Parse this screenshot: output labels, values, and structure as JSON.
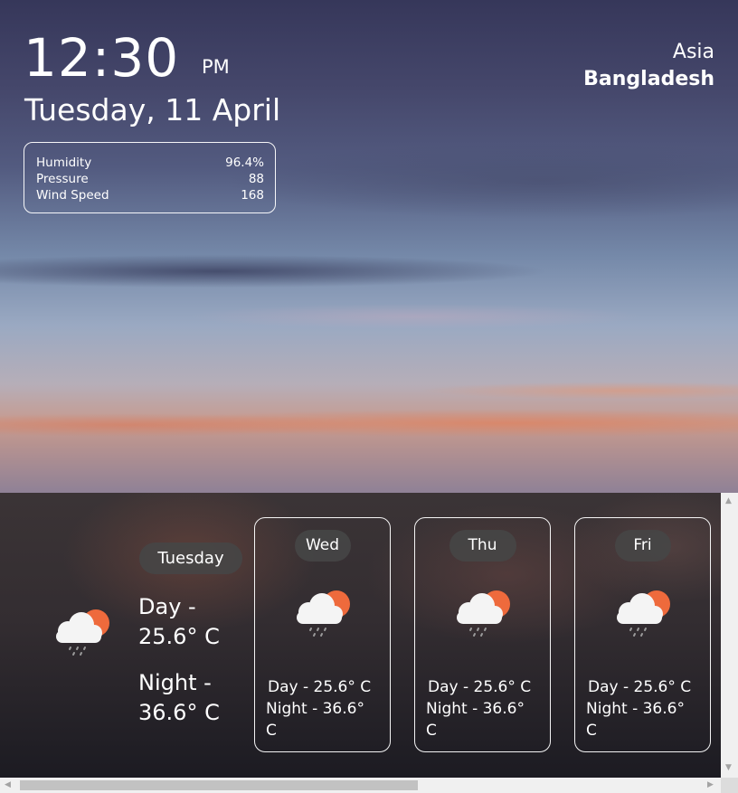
{
  "clock": {
    "time": "12:30",
    "meridiem": "PM",
    "date": "Tuesday, 11 April"
  },
  "location": {
    "region": "Asia",
    "country": "Bangladesh"
  },
  "stats": [
    {
      "label": "Humidity",
      "value": "96.4%"
    },
    {
      "label": "Pressure",
      "value": "88"
    },
    {
      "label": "Wind Speed",
      "value": "168"
    }
  ],
  "today": {
    "name": "Tuesday",
    "day": "Day - 25.6° C",
    "night": "Night - 36.6° C",
    "icon": "cloud-sun-rain-icon"
  },
  "forecast": [
    {
      "name": "Wed",
      "day": "Day - 25.6° C",
      "night": "Night - 36.6° C",
      "icon": "cloud-sun-rain-icon"
    },
    {
      "name": "Thu",
      "day": "Day - 25.6° C",
      "night": "Night - 36.6° C",
      "icon": "cloud-sun-rain-icon"
    },
    {
      "name": "Fri",
      "day": "Day - 25.6° C",
      "night": "Night - 36.6° C",
      "icon": "cloud-sun-rain-icon"
    }
  ],
  "colors": {
    "sun": "#ee6a3c",
    "cloud": "#f4f4f4",
    "pill": "#464646"
  }
}
